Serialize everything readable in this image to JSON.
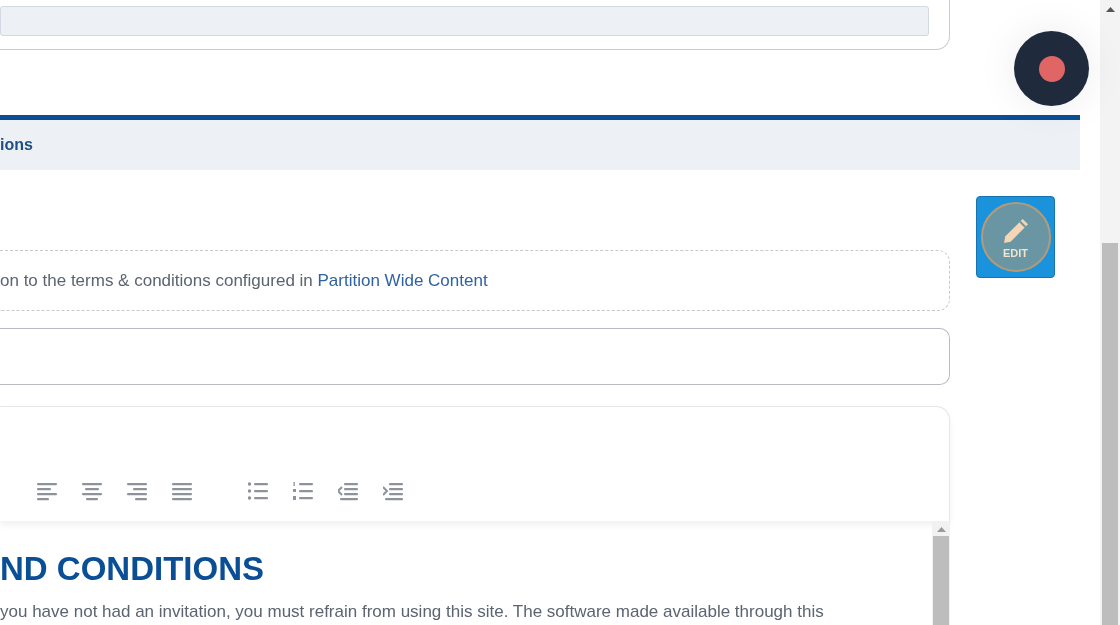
{
  "section_header": {
    "title": "ions"
  },
  "notice": {
    "text": "on to the terms & conditions configured in ",
    "link": "Partition Wide Content"
  },
  "editor": {
    "heading": "ND CONDITIONS",
    "paragraph": "you have not had an invitation, you must refrain from using this site. The software made available through this"
  },
  "edit_button": {
    "label": "EDIT"
  }
}
